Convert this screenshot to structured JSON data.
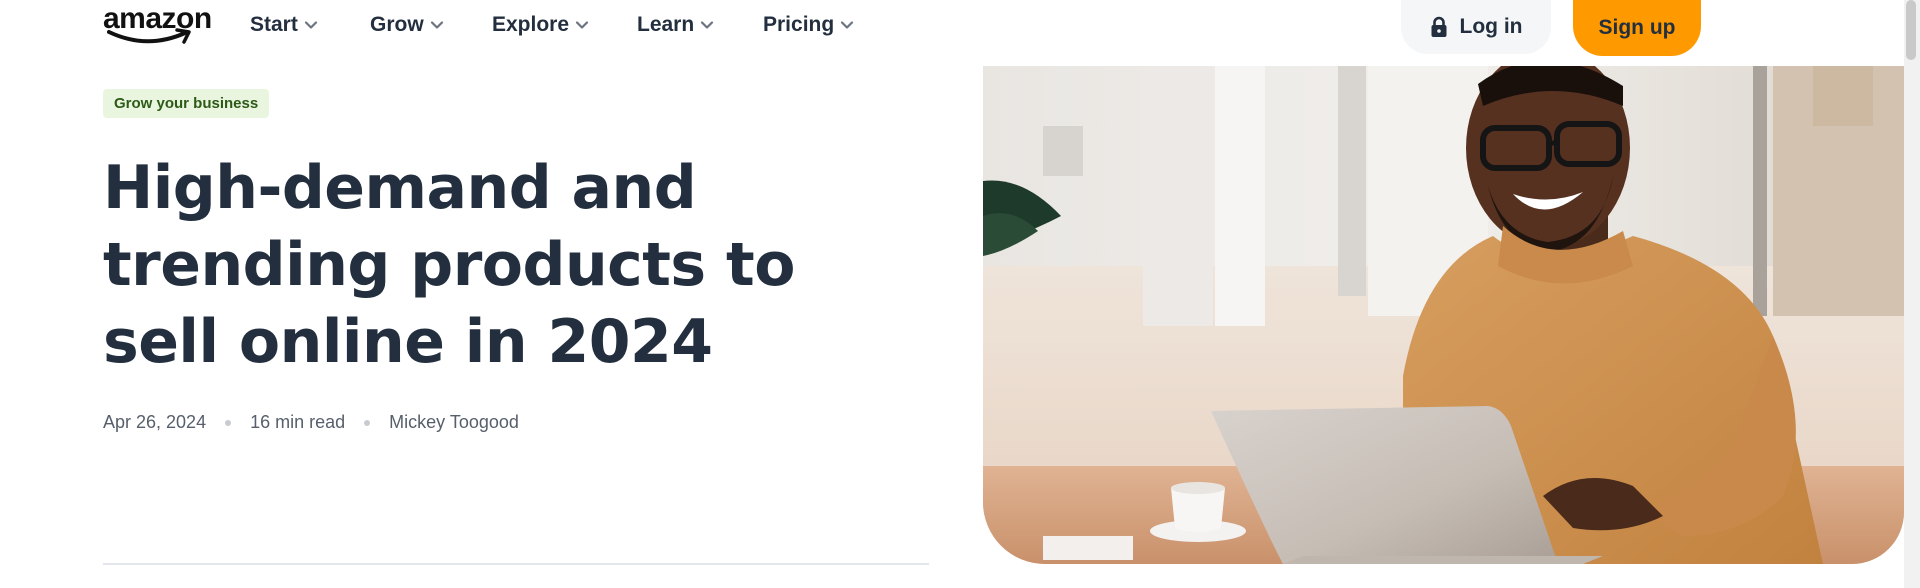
{
  "brand": {
    "logo_text": "amazon"
  },
  "nav": {
    "items": [
      {
        "label": "Start"
      },
      {
        "label": "Grow"
      },
      {
        "label": "Explore"
      },
      {
        "label": "Learn"
      },
      {
        "label": "Pricing"
      }
    ],
    "login_label": "Log in",
    "signup_label": "Sign up"
  },
  "article": {
    "category": "Grow your business",
    "title": "High-demand and trending products to sell online in 2024",
    "date": "Apr 26, 2024",
    "read_time": "16 min read",
    "author": "Mickey Toogood"
  },
  "icons": {
    "lock": "lock-icon",
    "chevron": "chevron-down-icon",
    "logo_smile": "amazon-smile-arrow"
  },
  "colors": {
    "primary_text": "#232f3e",
    "signup_accent": "#ff9900",
    "badge_bg": "#e9f5df",
    "badge_text": "#2d5a17",
    "login_bg": "#f5f6f7"
  }
}
